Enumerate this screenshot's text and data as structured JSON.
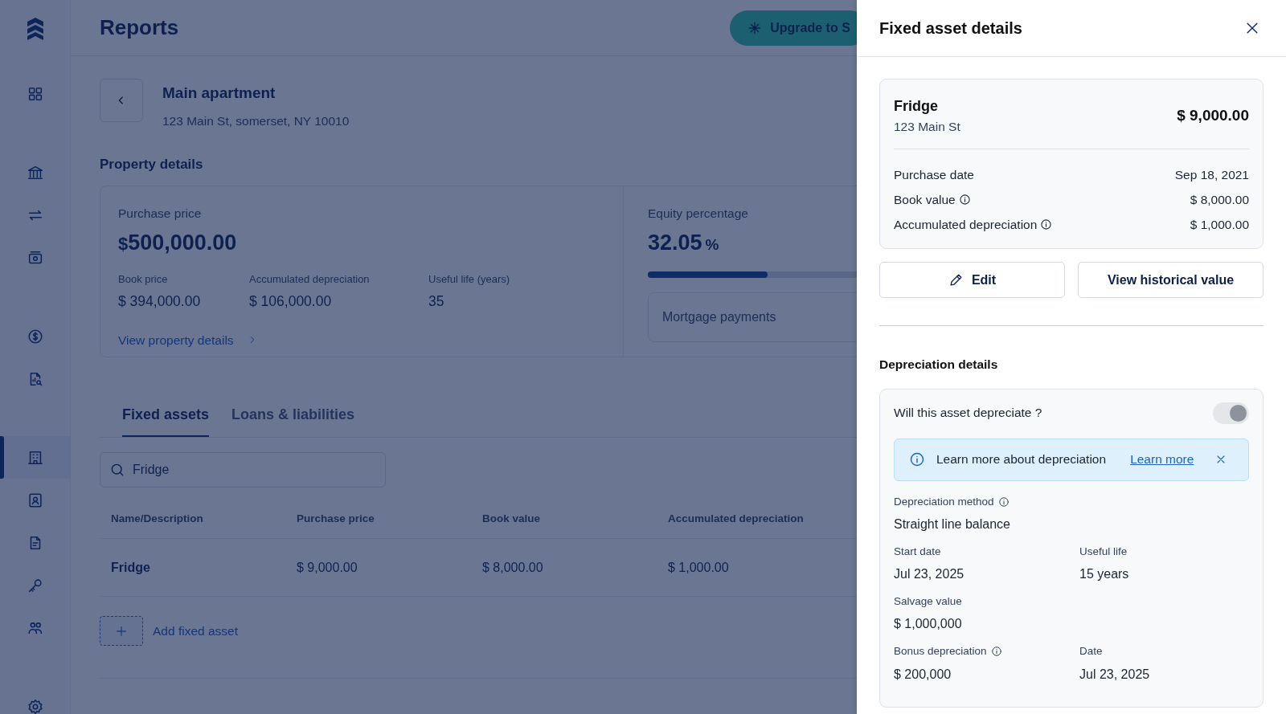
{
  "sidebar": {
    "groups": [
      [
        {
          "kind": "grid",
          "selected": false
        }
      ],
      [
        {
          "kind": "bank",
          "selected": false
        },
        {
          "kind": "transfer",
          "selected": false
        },
        {
          "kind": "wallet",
          "selected": false
        }
      ],
      [
        {
          "kind": "dollar",
          "selected": false
        },
        {
          "kind": "report",
          "selected": false
        }
      ],
      [
        {
          "kind": "building",
          "selected": true
        },
        {
          "kind": "contact",
          "selected": false
        },
        {
          "kind": "document",
          "selected": false
        },
        {
          "kind": "key",
          "selected": false
        },
        {
          "kind": "people",
          "selected": false
        }
      ],
      [
        {
          "kind": "gear",
          "selected": false
        }
      ]
    ]
  },
  "header": {
    "title": "Reports",
    "upgrade_button": "Upgrade to S"
  },
  "property": {
    "name": "Main apartment",
    "address": "123 Main St, somerset, NY 10010"
  },
  "property_details": {
    "heading": "Property details",
    "purchase_price_label": "Purchase price",
    "currency": "$",
    "purchase_price": "500,000.00",
    "stats": [
      {
        "label": "Book price",
        "value": "$ 394,000.00"
      },
      {
        "label": "Accumulated depreciation",
        "value": "$ 106,000.00"
      },
      {
        "label": "Useful life (years)",
        "value": "35"
      }
    ],
    "link": "View property details",
    "equity": {
      "label": "Equity percentage",
      "value": "32.05",
      "unit": "%",
      "level": 0.32
    },
    "mortgage": "Mortgage payments"
  },
  "tabs": [
    {
      "label": "Fixed assets",
      "selected": true
    },
    {
      "label": "Loans & liabilities",
      "selected": false
    }
  ],
  "search": {
    "value": "Fridge"
  },
  "table": {
    "columns": [
      "Name/Description",
      "Purchase price",
      "Book value",
      "Accumulated depreciation"
    ],
    "rows": [
      [
        "Fridge",
        "$ 9,000.00",
        "$ 8,000.00",
        "$ 1,000.00"
      ]
    ]
  },
  "add_button": "Add fixed asset",
  "panel": {
    "title": "Fixed asset details",
    "asset": {
      "name": "Fridge",
      "address": "123 Main St",
      "price": "$ 9,000.00"
    },
    "details": [
      {
        "label": "Purchase date",
        "value": "Sep 18, 2021",
        "info": false
      },
      {
        "label": "Book value",
        "value": "$ 8,000.00",
        "info": true
      },
      {
        "label": "Accumulated depreciation",
        "value": "$ 1,000.00",
        "info": true
      }
    ],
    "edit_button": "Edit",
    "history_button": "View historical value",
    "depreciation_heading": "Depreciation details",
    "toggle": {
      "label": "Will this asset depreciate ?",
      "on": true,
      "disabled": true
    },
    "alert": {
      "text": "Learn more about depreciation",
      "link": "Learn more"
    },
    "field_rows": [
      [
        {
          "label": "Depreciation method",
          "value": "Straight line balance",
          "info": true
        }
      ],
      [
        {
          "label": "Start date",
          "value": "Jul 23, 2025",
          "info": false
        },
        {
          "label": "Useful life",
          "value": "15 years",
          "info": false
        }
      ],
      [
        {
          "label": "Salvage value",
          "value": "$ 1,000,000",
          "info": false
        }
      ],
      [
        {
          "label": "Bonus depreciation",
          "value": "$ 200,000",
          "info": true
        },
        {
          "label": "Date",
          "value": "Jul 23, 2025",
          "info": false
        }
      ]
    ]
  }
}
